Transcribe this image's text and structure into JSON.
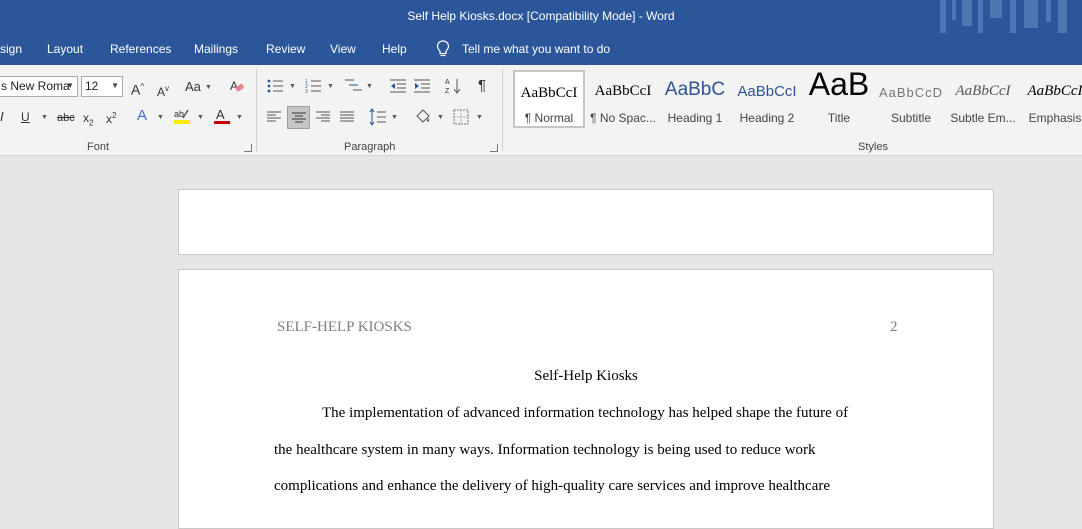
{
  "window": {
    "title": "Self Help Kiosks.docx [Compatibility Mode]  -  Word"
  },
  "tabs": [
    {
      "label": "sign"
    },
    {
      "label": "Layout"
    },
    {
      "label": "References"
    },
    {
      "label": "Mailings"
    },
    {
      "label": "Review"
    },
    {
      "label": "View"
    },
    {
      "label": "Help"
    }
  ],
  "tell_me": {
    "label": "Tell me what you want to do",
    "icon": "lightbulb-icon"
  },
  "font_group": {
    "label": "Font",
    "font_name": "s New Roma",
    "font_size": "12"
  },
  "paragraph_group": {
    "label": "Paragraph"
  },
  "styles_group": {
    "label": "Styles",
    "items": [
      {
        "sample": "AaBbCcI",
        "name": "¶ Normal"
      },
      {
        "sample": "AaBbCcI",
        "name": "¶ No Spac..."
      },
      {
        "sample": "AaBbC",
        "name": "Heading 1"
      },
      {
        "sample": "AaBbCcI",
        "name": "Heading 2"
      },
      {
        "sample": "AaB",
        "name": "Title"
      },
      {
        "sample": "AaBbCcD",
        "name": "Subtitle"
      },
      {
        "sample": "AaBbCcI",
        "name": "Subtle Em..."
      },
      {
        "sample": "AaBbCcI",
        "name": "Emphasis"
      }
    ]
  },
  "document": {
    "header_left": "SELF-HELP KIOSKS",
    "page_number": "2",
    "title": "Self-Help Kiosks",
    "lines": [
      "The implementation of advanced information technology has helped shape the future of",
      "the healthcare system in many ways. Information technology is being used to reduce work",
      "complications and enhance the delivery of high-quality care services and improve healthcare"
    ]
  },
  "colors": {
    "title_bar": "#2b579a",
    "ribbon": "#f3f3f3",
    "canvas": "#e6e6e6",
    "font_color_underline": "#c00000",
    "highlight_yellow": "#ffeb00"
  }
}
